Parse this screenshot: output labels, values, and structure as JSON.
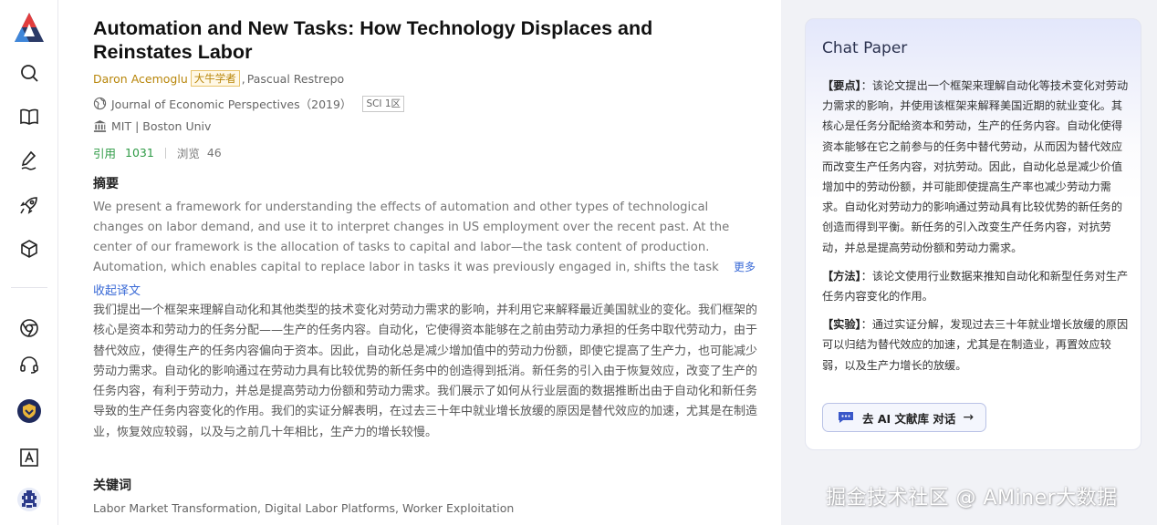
{
  "paper": {
    "title": "Automation and New Tasks: How Technology Displaces and Reinstates Labor",
    "authors": [
      {
        "name": "Daron Acemoglu",
        "badge": "大牛学者"
      },
      {
        "name": "Pascual Restrepo"
      }
    ],
    "author_sep": ",",
    "journal": "Journal of Economic Perspectives（2019）",
    "journal_badge": "SCI 1区",
    "affiliations": "MIT | Boston Univ",
    "citations_label": "引用",
    "citations": "1031",
    "views_label": "浏览",
    "views": "46",
    "abstract_heading": "摘要",
    "abstract_en": "We present a framework for understanding the effects of automation and other types of technological changes on labor demand, and use it to interpret changes in US employment over the recent past. At the center of our framework is the allocation of tasks to capital and labor—the task content of production. Automation, which enables capital to replace labor in tasks it was previously engaged in, shifts the task content of production against labor because of",
    "more_label": "更多",
    "collapse_label": "收起译文",
    "abstract_zh": "我们提出一个框架来理解自动化和其他类型的技术变化对劳动力需求的影响，并利用它来解释最近美国就业的变化。我们框架的核心是资本和劳动力的任务分配——生产的任务内容。自动化，它使得资本能够在之前由劳动力承担的任务中取代劳动力，由于替代效应，使得生产的任务内容偏向于资本。因此，自动化总是减少增加值中的劳动力份额，即使它提高了生产力，也可能减少劳动力需求。自动化的影响通过在劳动力具有比较优势的新任务中的创造得到抵消。新任务的引入由于恢复效应，改变了生产的任务内容，有利于劳动力，并总是提高劳动力份额和劳动力需求。我们展示了如何从行业层面的数据推断出由于自动化和新任务导致的生产任务内容变化的作用。我们的实证分解表明，在过去三十年中就业增长放缓的原因是替代效应的加速，尤其是在制造业，恢复效应较弱，以及与之前几十年相比，生产力的增长较慢。",
    "keywords_heading": "关键词",
    "keywords": "Labor Market Transformation,  Digital Labor Platforms,  Worker Exploitation"
  },
  "chat": {
    "title": "Chat Paper",
    "points_label": "【要点】",
    "points": "：该论文提出一个框架来理解自动化等技术变化对劳动力需求的影响，并使用该框架来解释美国近期的就业变化。其核心是任务分配给资本和劳动，生产的任务内容。自动化使得资本能够在它之前参与的任务中替代劳动，从而因为替代效应而改变生产任务内容，对抗劳动。因此，自动化总是减少价值增加中的劳动份额，并可能即使提高生产率也减少劳动力需求。自动化对劳动力的影响通过劳动具有比较优势的新任务的创造而得到平衡。新任务的引入改变生产任务内容，对抗劳动，并总是提高劳动份额和劳动力需求。",
    "method_label": "【方法】",
    "method": "：该论文使用行业数据来推知自动化和新型任务对生产任务内容变化的作用。",
    "experiment_label": "【实验】",
    "experiment": "：通过实证分解，发现过去三十年就业增长放缓的原因可以归结为替代效应的加速，尤其是在制造业，再置效应较弱，以及生产力增长的放缓。",
    "button_label": "去 AI 文献库 对话",
    "button_arrow": "→"
  },
  "watermark": "掘金技术社区 @ AMiner大数据",
  "colors": {
    "accent": "#3a6ad6",
    "green": "#2e9a45",
    "gold": "#b8860b"
  },
  "icons": [
    "logo-icon",
    "search-icon",
    "book-icon",
    "pen-icon",
    "rocket-icon",
    "cube-icon",
    "chrome-icon",
    "headset-icon",
    "shield-badge-icon",
    "font-icon",
    "pixel-avatar-icon",
    "globe-icon",
    "institution-icon",
    "chat-bubble-icon"
  ]
}
